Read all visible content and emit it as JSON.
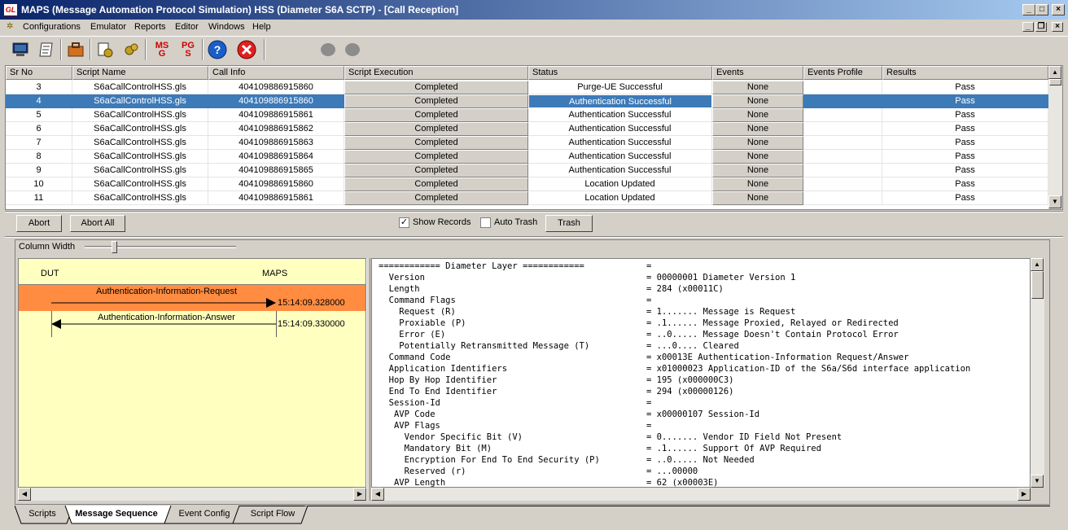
{
  "window": {
    "title": "MAPS (Message Automation Protocol Simulation) HSS (Diameter S6A SCTP) - [Call Reception]",
    "icon_text": "GL"
  },
  "menu": [
    "Configurations",
    "Emulator",
    "Reports",
    "Editor",
    "Windows",
    "Help"
  ],
  "toolbar": {
    "icons": [
      "monitor-icon",
      "notepad-icon",
      "briefcase-icon",
      "configure-icon",
      "gears-icon",
      "msg-icon",
      "pgs-icon",
      "help-icon",
      "stop-icon",
      "status-led-icon",
      "status-led-icon"
    ],
    "msg_text": [
      "MS",
      "G"
    ],
    "pgs_text": [
      "PG",
      "S"
    ]
  },
  "table": {
    "headers": [
      "Sr No",
      "Script Name",
      "Call Info",
      "Script Execution",
      "Status",
      "Events",
      "Events Profile",
      "Results"
    ],
    "rows": [
      [
        "3",
        "S6aCallControlHSS.gls",
        "404109886915860",
        "Completed",
        "Purge-UE Successful",
        "None",
        "",
        "Pass"
      ],
      [
        "4",
        "S6aCallControlHSS.gls",
        "404109886915860",
        "Completed",
        "Authentication Successful",
        "None",
        "",
        "Pass"
      ],
      [
        "5",
        "S6aCallControlHSS.gls",
        "404109886915861",
        "Completed",
        "Authentication Successful",
        "None",
        "",
        "Pass"
      ],
      [
        "6",
        "S6aCallControlHSS.gls",
        "404109886915862",
        "Completed",
        "Authentication Successful",
        "None",
        "",
        "Pass"
      ],
      [
        "7",
        "S6aCallControlHSS.gls",
        "404109886915863",
        "Completed",
        "Authentication Successful",
        "None",
        "",
        "Pass"
      ],
      [
        "8",
        "S6aCallControlHSS.gls",
        "404109886915864",
        "Completed",
        "Authentication Successful",
        "None",
        "",
        "Pass"
      ],
      [
        "9",
        "S6aCallControlHSS.gls",
        "404109886915865",
        "Completed",
        "Authentication Successful",
        "None",
        "",
        "Pass"
      ],
      [
        "10",
        "S6aCallControlHSS.gls",
        "404109886915860",
        "Completed",
        "Location Updated",
        "None",
        "",
        "Pass"
      ],
      [
        "11",
        "S6aCallControlHSS.gls",
        "404109886915861",
        "Completed",
        "Location Updated",
        "None",
        "",
        "Pass"
      ]
    ],
    "selected_row": "4"
  },
  "controls": {
    "abort": "Abort",
    "abort_all": "Abort All",
    "show_records": "Show Records",
    "show_records_checked": true,
    "auto_trash": "Auto Trash",
    "auto_trash_checked": false,
    "trash": "Trash",
    "column_width": "Column Width",
    "column_width_value": 0.2
  },
  "sequence": {
    "left_entity": "DUT",
    "right_entity": "MAPS",
    "messages": [
      {
        "label": "Authentication-Information-Request",
        "time": "15:14:09.328000",
        "direction": "right",
        "highlighted": true
      },
      {
        "label": "Authentication-Information-Answer",
        "time": "15:14:09.330000",
        "direction": "left",
        "highlighted": false
      }
    ]
  },
  "detail_lines": [
    [
      "============ Diameter Layer ============",
      "="
    ],
    [
      "  Version",
      "= 00000001 Diameter Version 1"
    ],
    [
      "  Length",
      "= 284 (x00011C)"
    ],
    [
      "  Command Flags",
      "="
    ],
    [
      "    Request (R)",
      "= 1....... Message is Request"
    ],
    [
      "    Proxiable (P)",
      "= .1...... Message Proxied, Relayed or Redirected"
    ],
    [
      "    Error (E)",
      "= ..0..... Message Doesn't Contain Protocol Error"
    ],
    [
      "    Potentially Retransmitted Message (T)",
      "= ...0.... Cleared"
    ],
    [
      "  Command Code",
      "= x00013E Authentication-Information Request/Answer"
    ],
    [
      "  Application Identifiers",
      "= x01000023 Application-ID of the S6a/S6d interface application"
    ],
    [
      "  Hop By Hop Identifier",
      "= 195 (x000000C3)"
    ],
    [
      "  End To End Identifier",
      "= 294 (x00000126)"
    ],
    [
      "  Session-Id",
      "="
    ],
    [
      "   AVP Code",
      "= x00000107 Session-Id"
    ],
    [
      "   AVP Flags",
      "="
    ],
    [
      "     Vendor Specific Bit (V)",
      "= 0....... Vendor ID Field Not Present"
    ],
    [
      "     Mandatory Bit (M)",
      "= .1...... Support Of AVP Required"
    ],
    [
      "     Encryption For End To End Security (P)",
      "= ..0..... Not Needed"
    ],
    [
      "     Reserved (r)",
      "= ...00000"
    ],
    [
      "   AVP Length",
      "= 62 (x00003E)"
    ]
  ],
  "tabs": [
    "Scripts",
    "Message Sequence",
    "Event Config",
    "Script Flow"
  ],
  "active_tab": "Message Sequence",
  "colors": {
    "title_start": "#0a246a",
    "title_end": "#a6caf0",
    "selection": "#3d7ab8",
    "highlight_row": "#ff8c40",
    "sequence_bg": "#ffffc0"
  }
}
